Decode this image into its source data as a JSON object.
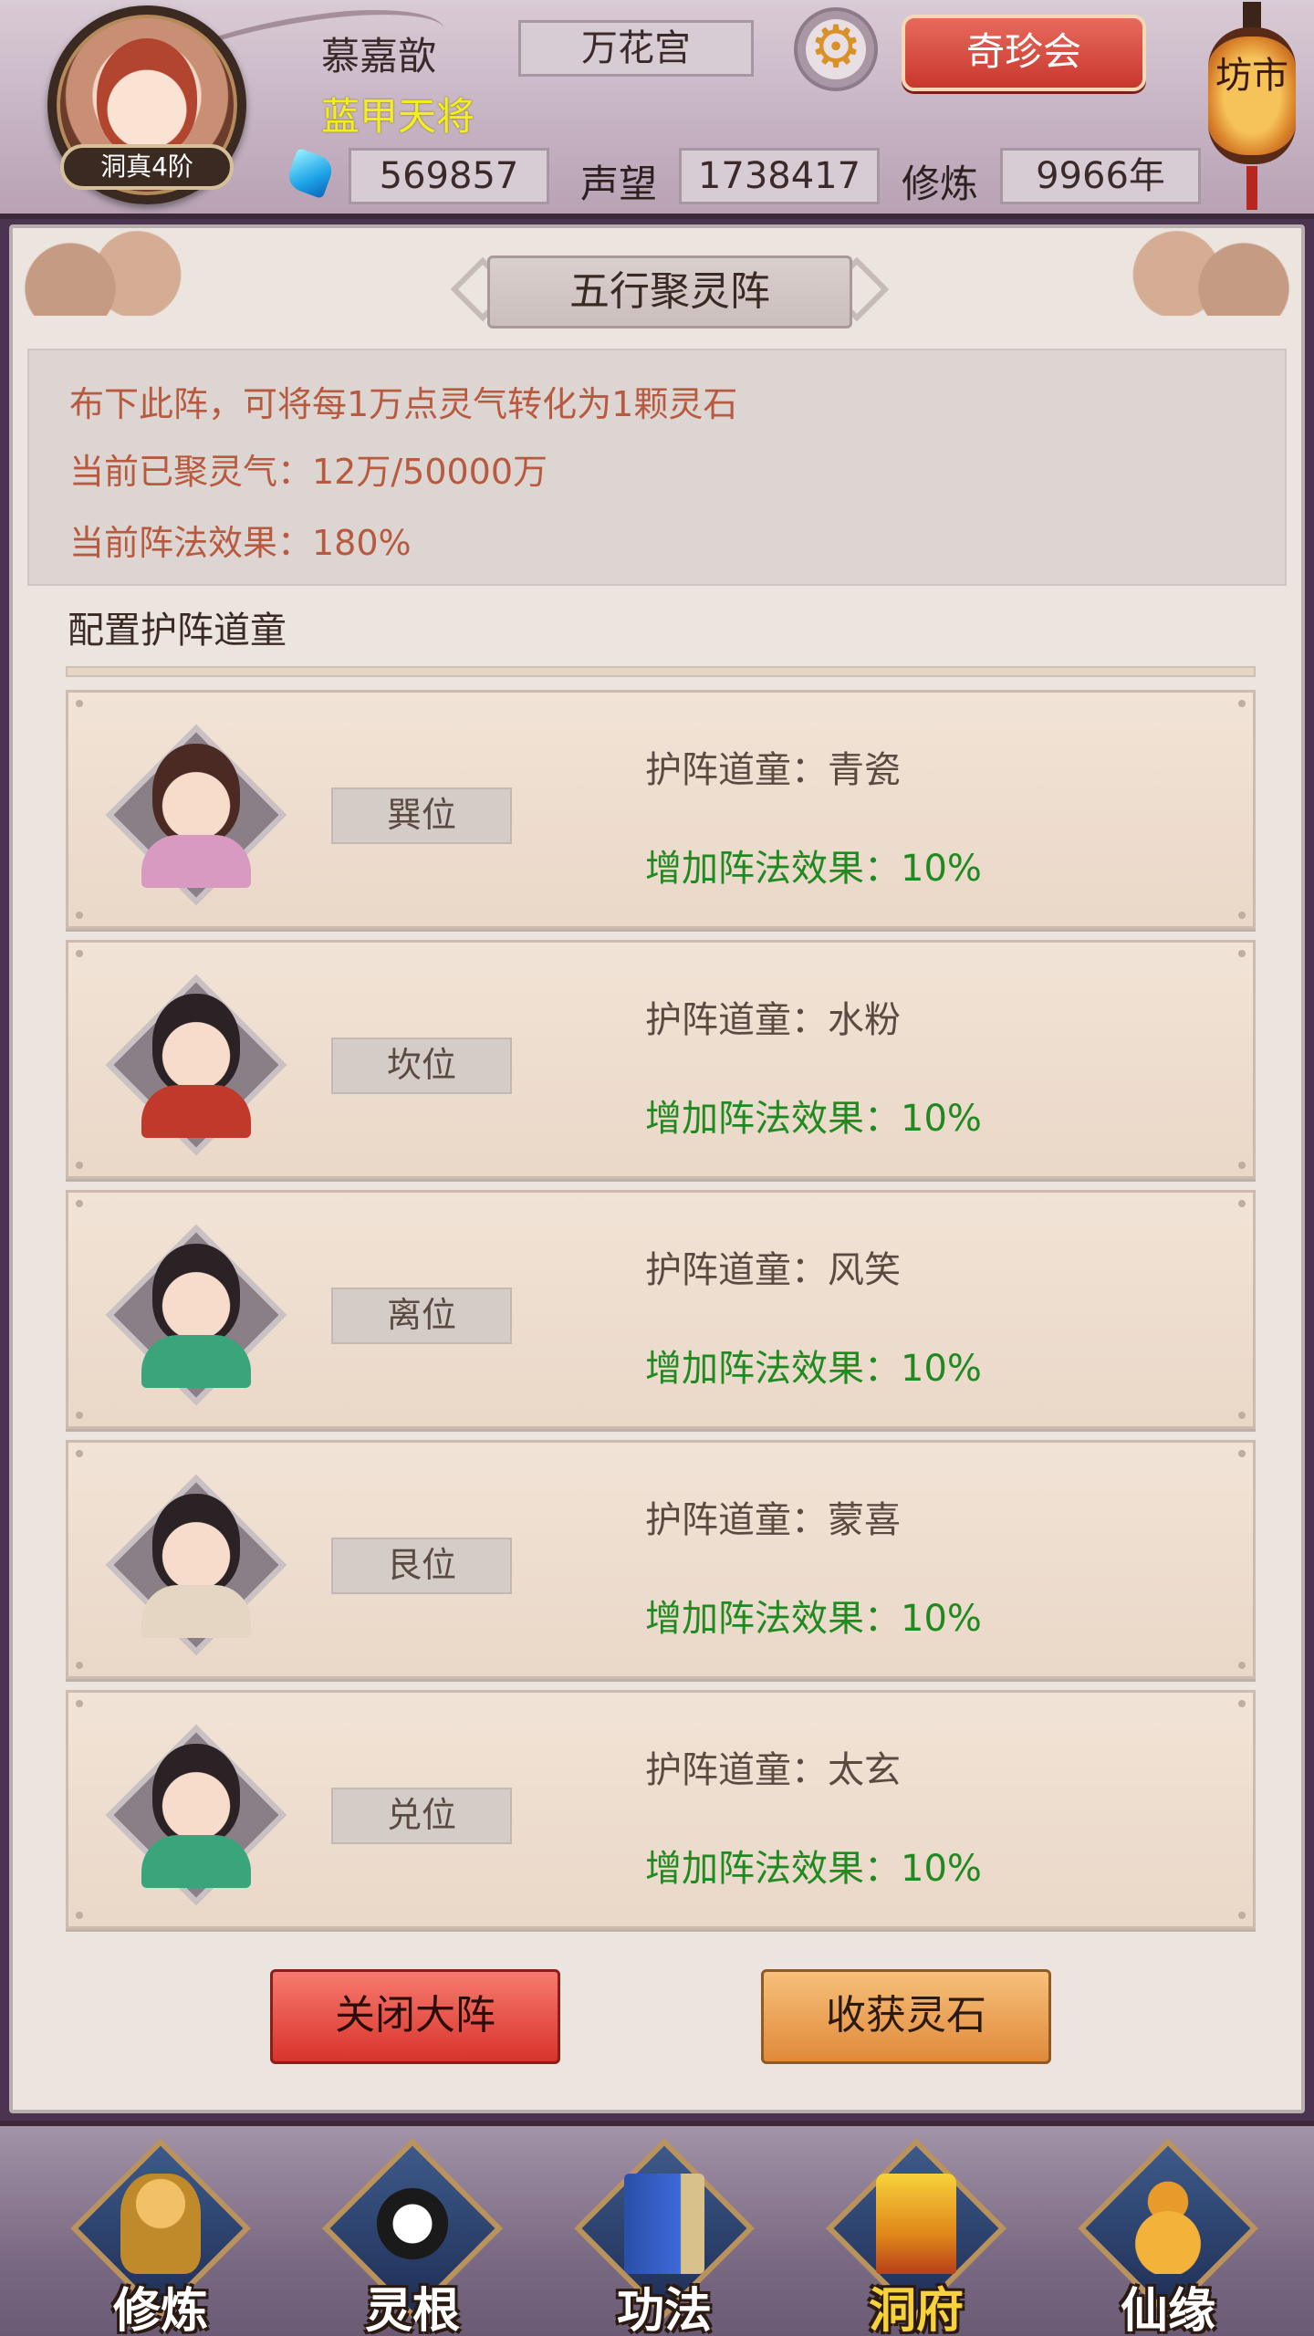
{
  "player": {
    "name": "慕嘉歆",
    "title": "蓝甲天将",
    "rank": "洞真4阶",
    "sect": "万花宫",
    "treasure_button": "奇珍会",
    "market_label": "坊市",
    "gems": "569857",
    "prestige_label": "声望",
    "prestige": "1738417",
    "cultivation_label": "修炼",
    "cultivation": "9966年"
  },
  "panel": {
    "title": "五行聚灵阵",
    "info": [
      "布下此阵，可将每1万点灵气转化为1颗灵石",
      "当前已聚灵气：12万/50000万",
      "当前阵法效果：180%"
    ],
    "section_label": "配置护阵道童",
    "slots": [
      {
        "position": "巽位",
        "acolyte": "护阵道童：青瓷",
        "bonus": "增加阵法效果：10%"
      },
      {
        "position": "坎位",
        "acolyte": "护阵道童：水粉",
        "bonus": "增加阵法效果：10%"
      },
      {
        "position": "离位",
        "acolyte": "护阵道童：风笑",
        "bonus": "增加阵法效果：10%"
      },
      {
        "position": "艮位",
        "acolyte": "护阵道童：蒙喜",
        "bonus": "增加阵法效果：10%"
      },
      {
        "position": "兑位",
        "acolyte": "护阵道童：太玄",
        "bonus": "增加阵法效果：10%"
      }
    ],
    "buttons": {
      "close": "关闭大阵",
      "harvest": "收获灵石"
    }
  },
  "nav": [
    {
      "label": "修炼",
      "icon": "monk-icon"
    },
    {
      "label": "灵根",
      "icon": "sword-taiji-icon"
    },
    {
      "label": "功法",
      "icon": "book-icon"
    },
    {
      "label": "洞府",
      "icon": "pagoda-icon",
      "active": true
    },
    {
      "label": "仙缘",
      "icon": "gourd-icon"
    }
  ],
  "colors": {
    "accent_red": "#d8332b",
    "accent_orange": "#e08a3a",
    "bonus_green": "#1f8a1f",
    "title_yellow": "#f3ef1d",
    "info_text": "#b85a3f"
  }
}
